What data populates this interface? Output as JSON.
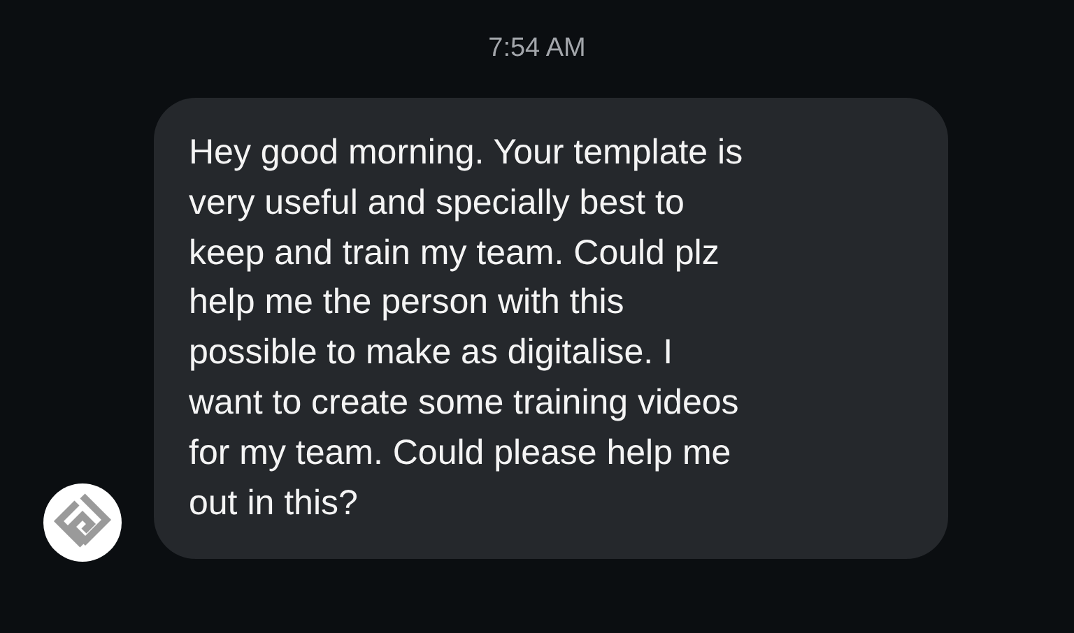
{
  "timestamp": "7:54 AM",
  "message": {
    "text": "Hey good morning. Your template is\nvery useful and specially best to\nkeep and train my team. Could plz\nhelp me the person with this\npossible to make as digitalise. I\nwant to create some training videos\nfor my team. Could please help me\nout in this?"
  }
}
